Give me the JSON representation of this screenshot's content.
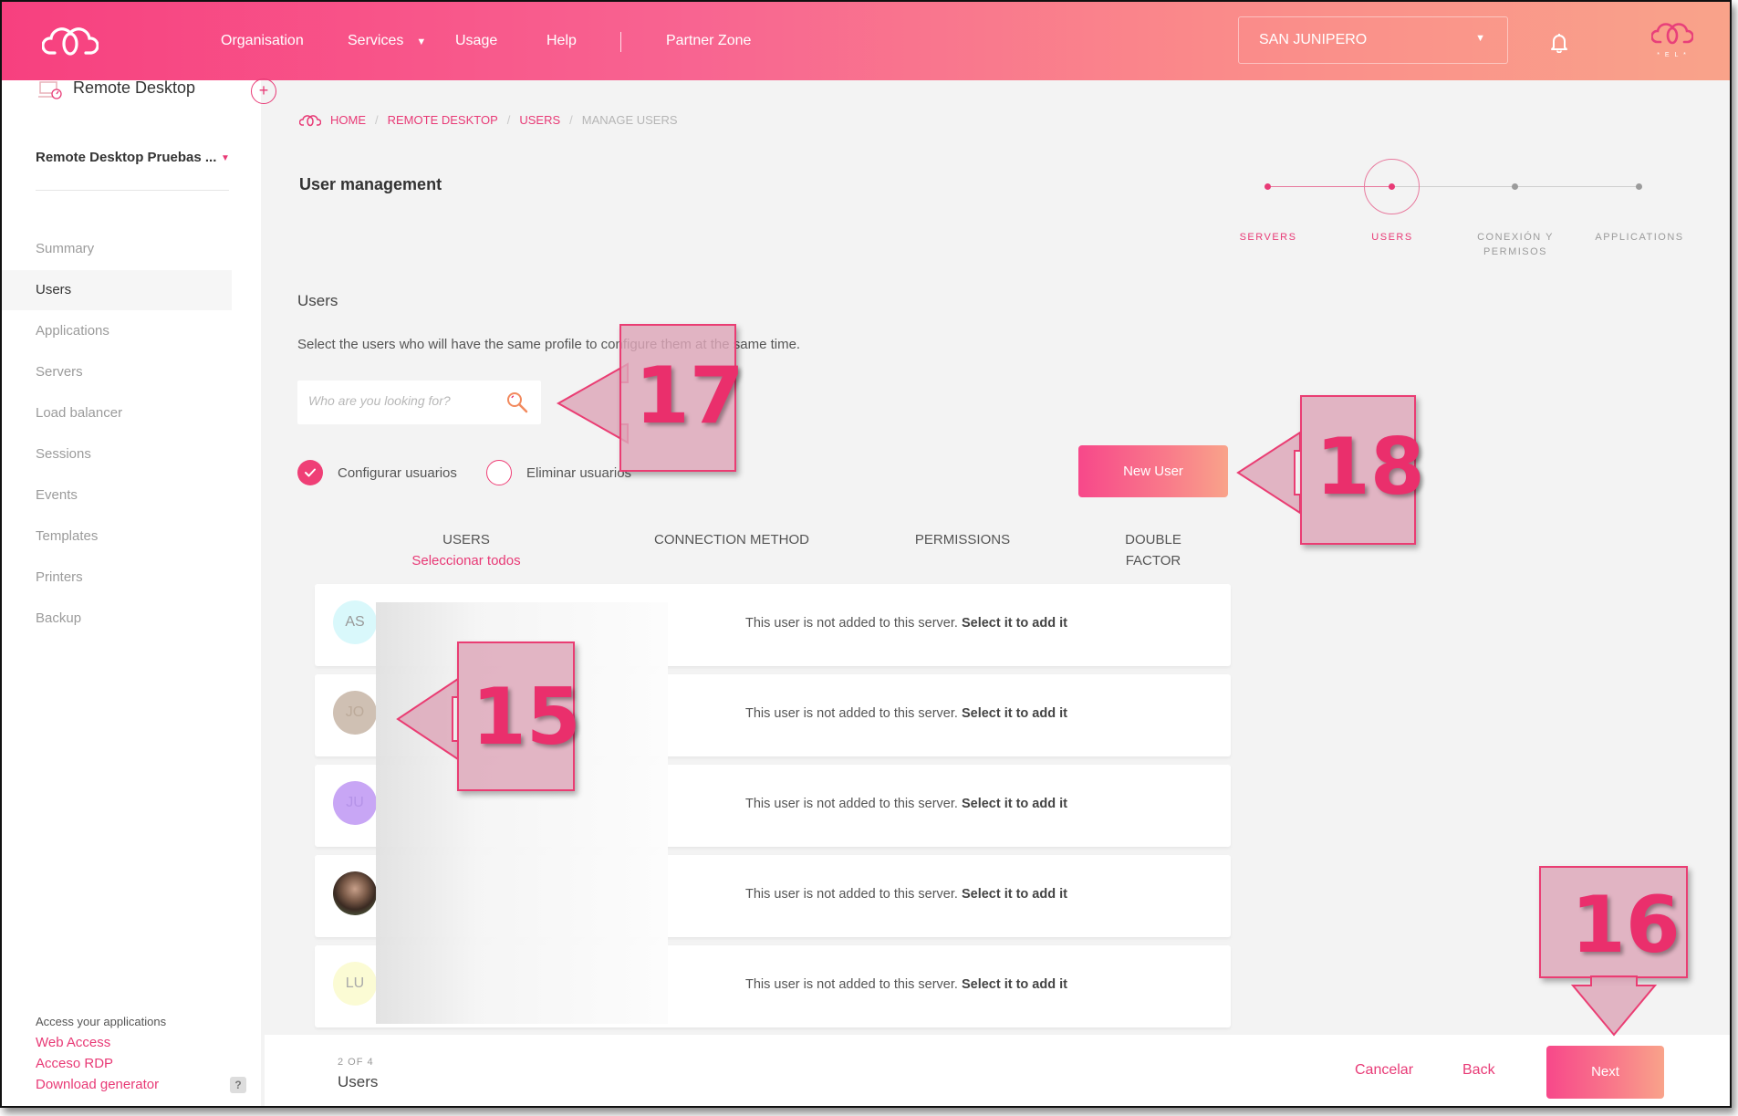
{
  "topbar": {
    "nav": [
      {
        "label": "Organisation"
      },
      {
        "label": "Services",
        "has_dropdown": true
      },
      {
        "label": "Usage"
      },
      {
        "label": "Help"
      },
      {
        "label": "Partner Zone"
      }
    ],
    "org_selector": {
      "value": "SAN JUNIPERO",
      "caret": "▼"
    },
    "icons": {
      "logo": "cloud-logo-icon",
      "notifications": "bell-icon",
      "tenant_logo": "tenant-logo-icon"
    },
    "tenant_logo_text": "* E L *"
  },
  "sidebar": {
    "product_title": "Remote Desktop",
    "add_label": "+",
    "project": "Remote Desktop Pruebas ...",
    "project_caret": "▼",
    "items": [
      {
        "label": "Summary",
        "active": false
      },
      {
        "label": "Users",
        "active": true
      },
      {
        "label": "Applications",
        "active": false
      },
      {
        "label": "Servers",
        "active": false
      },
      {
        "label": "Load balancer",
        "active": false
      },
      {
        "label": "Sessions",
        "active": false
      },
      {
        "label": "Events",
        "active": false
      },
      {
        "label": "Templates",
        "active": false
      },
      {
        "label": "Printers",
        "active": false
      },
      {
        "label": "Backup",
        "active": false
      }
    ],
    "access_label": "Access your applications",
    "access_links": [
      {
        "label": "Web Access"
      },
      {
        "label": "Acceso RDP"
      },
      {
        "label": "Download generator"
      }
    ],
    "help_label": "?"
  },
  "breadcrumb": {
    "items": [
      {
        "label": "HOME",
        "link": true
      },
      {
        "label": "REMOTE DESKTOP",
        "link": true
      },
      {
        "label": "USERS",
        "link": true
      },
      {
        "label": "MANAGE USERS",
        "link": false
      }
    ],
    "separator": "/"
  },
  "page": {
    "title": "User management",
    "section_title": "Users",
    "description": "Select the users who will have the same profile to configure them at the same time."
  },
  "stepper": {
    "current_index": 1,
    "steps": [
      {
        "label": "SERVERS",
        "state": "done"
      },
      {
        "label": "USERS",
        "state": "current"
      },
      {
        "label": "CONEXIÓN Y PERMISOS",
        "state": "pending"
      },
      {
        "label": "APPLICATIONS",
        "state": "pending"
      }
    ],
    "colors": {
      "active": "#e83a76",
      "inactive": "#9b9b9b"
    }
  },
  "search": {
    "placeholder": "Who are you looking for?",
    "value": ""
  },
  "mode": {
    "options": [
      {
        "label": "Configurar usuarios",
        "checked": true
      },
      {
        "label": "Eliminar usuarios",
        "checked": false
      }
    ]
  },
  "new_user_label": "New User",
  "table": {
    "columns": [
      {
        "label": "USERS",
        "sub": "Seleccionar todos"
      },
      {
        "label": "CONNECTION METHOD"
      },
      {
        "label": "PERMISSIONS"
      },
      {
        "label": "DOUBLE FACTOR",
        "lines": [
          "DOUBLE",
          "FACTOR"
        ]
      }
    ],
    "rows": [
      {
        "initials": "AS",
        "avatar_color": "#d9f8fb",
        "name_redacted": true,
        "message": "This user is not added to this server.",
        "action": "Select it to add it"
      },
      {
        "initials": "JO",
        "avatar_color": "#cfc0b3",
        "name_redacted": true,
        "message": "This user is not added to this server.",
        "action": "Select it to add it"
      },
      {
        "initials": "JU",
        "avatar_color": "#c8a6f5",
        "name_redacted": true,
        "message": "This user is not added to this server.",
        "action": "Select it to add it"
      },
      {
        "initials": "",
        "avatar_photo": true,
        "avatar_color": "#4a3a30",
        "name_redacted": true,
        "message": "This user is not added to this server.",
        "action": "Select it to add it"
      },
      {
        "initials": "LU",
        "avatar_color": "#fbfbd4",
        "name_redacted": true,
        "message": "This user is not added to this server.",
        "action": "Select it to add it"
      }
    ]
  },
  "footer": {
    "progress_text": "2 OF 4",
    "step_name": "Users",
    "cancel_label": "Cancelar",
    "back_label": "Back",
    "next_label": "Next"
  },
  "annotations": [
    {
      "number": "15",
      "direction": "left"
    },
    {
      "number": "16",
      "direction": "down"
    },
    {
      "number": "17",
      "direction": "left"
    },
    {
      "number": "18",
      "direction": "left"
    }
  ],
  "colors": {
    "brand_pink": "#e83a76",
    "gradient_start": "#f7407f",
    "gradient_end": "#f9a38a",
    "background": "#f3f3f3"
  }
}
